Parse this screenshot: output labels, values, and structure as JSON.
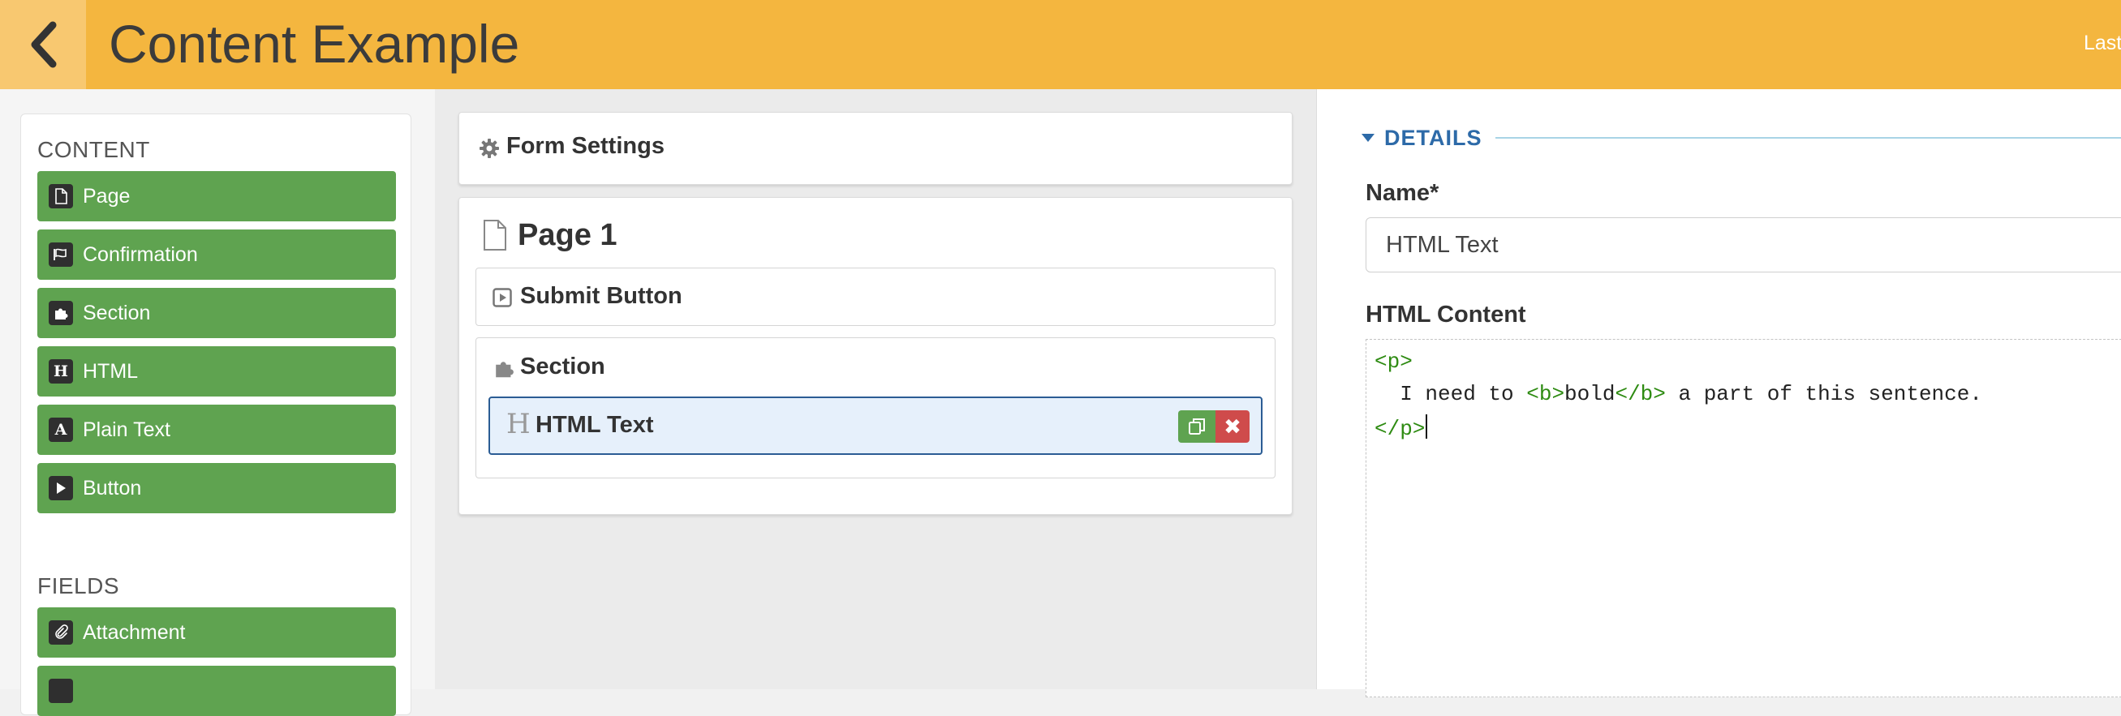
{
  "header": {
    "title": "Content Example",
    "right_text": "Last"
  },
  "palette": {
    "content_heading": "CONTENT",
    "content_items": [
      {
        "label": "Page",
        "icon": "page-icon"
      },
      {
        "label": "Confirmation",
        "icon": "confirmation-icon"
      },
      {
        "label": "Section",
        "icon": "puzzle-icon"
      },
      {
        "label": "HTML",
        "icon": "html-icon"
      },
      {
        "label": "Plain Text",
        "icon": "text-icon"
      },
      {
        "label": "Button",
        "icon": "play-icon"
      }
    ],
    "fields_heading": "FIELDS",
    "field_items": [
      {
        "label": "Attachment",
        "icon": "paperclip-icon"
      }
    ]
  },
  "builder": {
    "form_settings_label": "Form Settings",
    "page_title": "Page 1",
    "submit_label": "Submit Button",
    "section_label": "Section",
    "html_text_label": "HTML Text"
  },
  "details": {
    "heading": "DETAILS",
    "name_label": "Name*",
    "name_value": "HTML Text",
    "html_content_label": "HTML Content",
    "code": {
      "open_tag": "<p>",
      "text_pre": "  I need to ",
      "b_open": "<b>",
      "bold_word": "bold",
      "b_close": "</b>",
      "text_post": " a part of this sentence.",
      "close_tag": "</p>"
    }
  },
  "colors": {
    "header": "#f4b63f",
    "palette_green": "#5fa350",
    "accent_blue": "#2d6aa8",
    "code_tag_green": "#2e8b12",
    "delete_red": "#cf4b4b"
  }
}
